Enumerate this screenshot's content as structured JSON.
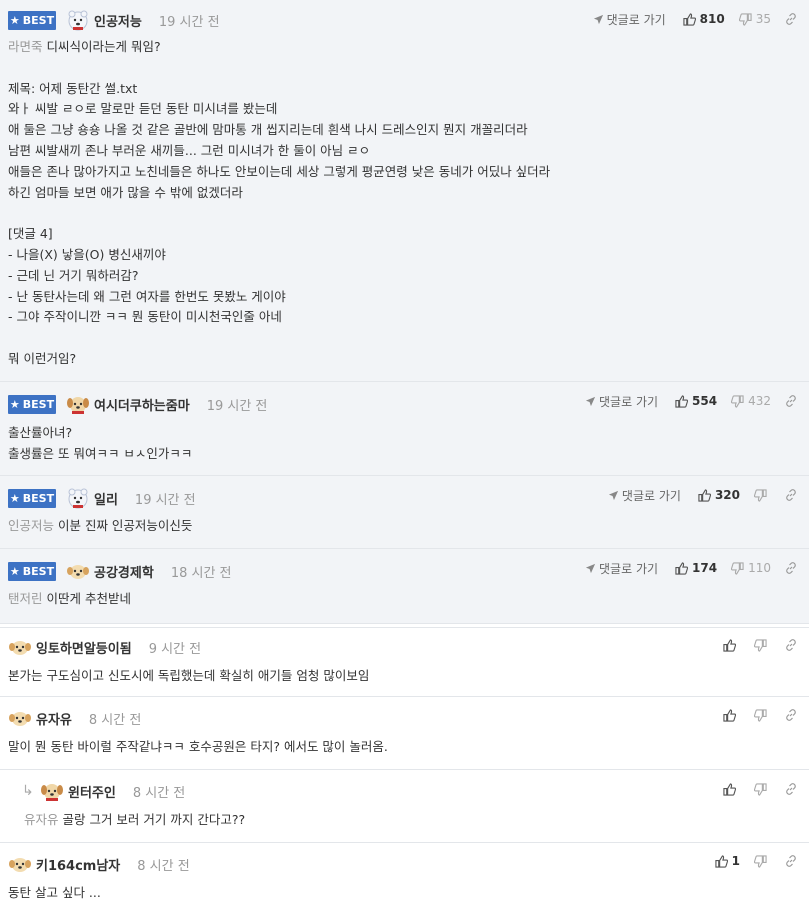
{
  "comments": [
    {
      "best_label": "BEST",
      "nick": "인공저능",
      "time": "19 시간 전",
      "goto_label": "댓글로 가기",
      "likes": "810",
      "dislikes": "35",
      "mention": "라면죽",
      "lines": [
        " 디씨식이라는게 뭐임?",
        "",
        "제목: 어제 동탄간 썰.txt",
        "와ㅏ 씨발 ㄹㅇ로 말로만 듣던 동탄 미시녀를 봤는데",
        "애 둘은 그냥 숑숑 나올 것 같은 골반에 맘마통 개 씹지리는데 흰색 나시 드레스인지 뭔지 개꼴리더라",
        "남편 씨발새끼 존나 부러운 새끼들... 그런 미시녀가 한 둘이 아님 ㄹㅇ",
        "애들은 존나 많아가지고 노친네들은 하나도 안보이는데 세상 그렇게 평균연령 낮은 동네가 어딨나 싶더라",
        "하긴 엄마들 보면 애가 많을 수 밖에 없겠더라",
        "",
        "[댓글 4]",
        "- 나을(X) 낳을(O) 병신새끼야",
        "- 근데 닌 거기 뭐하러감?",
        "- 난 동탄사는데 왜 그런 여자를 한번도 못봤노 게이야",
        "- 그야 주작이니깐 ㅋㅋ 뭔 동탄이 미시천국인줄 아네",
        "",
        "뭐 이런거임?"
      ]
    },
    {
      "best_label": "BEST",
      "nick": "여시더쿠하는줌마",
      "time": "19 시간 전",
      "goto_label": "댓글로 가기",
      "likes": "554",
      "dislikes": "432",
      "mention": "",
      "lines": [
        "출산률아녀?",
        "출생률은 또 뭐여ㅋㅋ ㅂㅅ인가ㅋㅋ"
      ]
    },
    {
      "best_label": "BEST",
      "nick": "일리",
      "time": "19 시간 전",
      "goto_label": "댓글로 가기",
      "likes": "320",
      "dislikes": "",
      "mention": "인공저능",
      "lines": [
        " 이분 진짜 인공저능이신듯"
      ]
    },
    {
      "best_label": "BEST",
      "nick": "공강경제학",
      "time": "18 시간 전",
      "goto_label": "댓글로 가기",
      "likes": "174",
      "dislikes": "110",
      "mention": "탠저린",
      "lines": [
        " 이딴게 추천받네"
      ]
    },
    {
      "nick": "잉토하면알등이됨",
      "time": "9 시간 전",
      "likes": "",
      "mention": "",
      "lines": [
        "본가는 구도심이고 신도시에 독립했는데 확실히 애기들 엄청 많이보임"
      ]
    },
    {
      "nick": "유자유",
      "time": "8 시간 전",
      "likes": "",
      "mention": "",
      "lines": [
        "말이 뭔 동탄 바이럴 주작같냐ㅋㅋ 호수공원은 타지? 에서도 많이 놀러옴."
      ]
    },
    {
      "nick": "윈터주인",
      "time": "8 시간 전",
      "likes": "",
      "mention": "유자유",
      "lines": [
        " 골랑 그거 보러 거기 까지 간다고??"
      ]
    },
    {
      "nick": "키164cm남자",
      "time": "8 시간 전",
      "likes": "1",
      "mention": "",
      "lines": [
        "동탄 살고 싶다 ..."
      ]
    }
  ],
  "colors": {
    "best_badge": "#3d72c4",
    "best_bg": "#f2f4f7",
    "muted": "#999999"
  }
}
